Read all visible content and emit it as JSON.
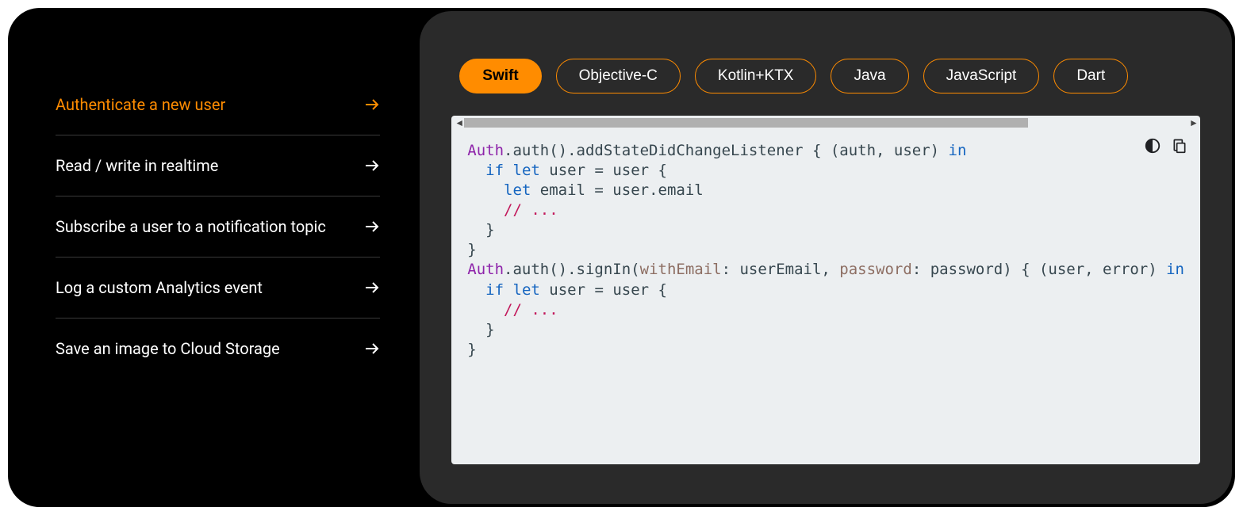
{
  "colors": {
    "accent": "#ff8c00"
  },
  "sidebar": {
    "items": [
      {
        "label": "Authenticate a new user",
        "active": true
      },
      {
        "label": "Read / write in realtime",
        "active": false
      },
      {
        "label": "Subscribe a user to a notification topic",
        "active": false
      },
      {
        "label": "Log a custom Analytics event",
        "active": false
      },
      {
        "label": "Save an image to Cloud Storage",
        "active": false
      }
    ]
  },
  "tabs": [
    {
      "label": "Swift",
      "active": true
    },
    {
      "label": "Objective-C",
      "active": false
    },
    {
      "label": "Kotlin+KTX",
      "active": false
    },
    {
      "label": "Java",
      "active": false
    },
    {
      "label": "JavaScript",
      "active": false
    },
    {
      "label": "Dart",
      "active": false
    }
  ],
  "code": {
    "tokens": [
      {
        "t": "Auth",
        "c": "kw-purple"
      },
      {
        "t": ".auth().addStateDidChangeListener { (auth, user) "
      },
      {
        "t": "in",
        "c": "kw-blue"
      },
      {
        "t": "\n"
      },
      {
        "t": "  "
      },
      {
        "t": "if",
        "c": "kw-blue"
      },
      {
        "t": " "
      },
      {
        "t": "let",
        "c": "kw-blue"
      },
      {
        "t": " user = user {\n"
      },
      {
        "t": "    "
      },
      {
        "t": "let",
        "c": "kw-blue"
      },
      {
        "t": " email = user.email\n"
      },
      {
        "t": "    "
      },
      {
        "t": "// ...",
        "c": "comment"
      },
      {
        "t": "\n"
      },
      {
        "t": "  }\n"
      },
      {
        "t": "}\n"
      },
      {
        "t": "Auth",
        "c": "kw-purple"
      },
      {
        "t": ".auth().signIn("
      },
      {
        "t": "withEmail",
        "c": "kw-brown"
      },
      {
        "t": ": userEmail, "
      },
      {
        "t": "password",
        "c": "kw-brown"
      },
      {
        "t": ": password) { (user, error) "
      },
      {
        "t": "in",
        "c": "kw-blue"
      },
      {
        "t": "\n"
      },
      {
        "t": "  "
      },
      {
        "t": "if",
        "c": "kw-blue"
      },
      {
        "t": " "
      },
      {
        "t": "let",
        "c": "kw-blue"
      },
      {
        "t": " user = user {\n"
      },
      {
        "t": "    "
      },
      {
        "t": "// ...",
        "c": "comment"
      },
      {
        "t": "\n"
      },
      {
        "t": "  }\n"
      },
      {
        "t": "}"
      }
    ]
  }
}
